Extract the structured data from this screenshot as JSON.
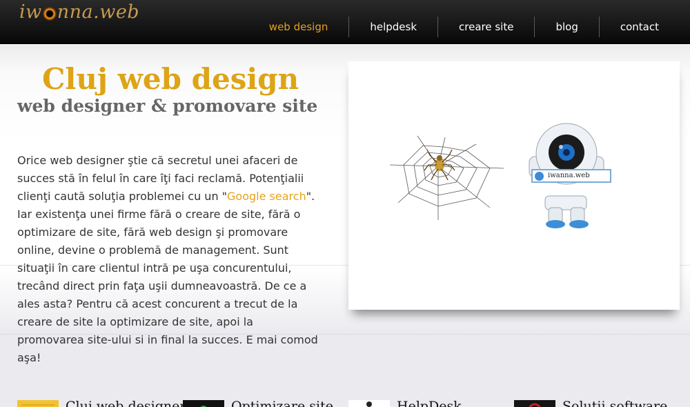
{
  "header": {
    "logo_text_left": "iw",
    "logo_text_right": "nna.web",
    "nav": [
      {
        "label": "web design",
        "active": true
      },
      {
        "label": "helpdesk",
        "active": false
      },
      {
        "label": "creare site",
        "active": false
      },
      {
        "label": "blog",
        "active": false
      },
      {
        "label": "contact",
        "active": false
      }
    ]
  },
  "hero": {
    "title": "Cluj web design",
    "subtitle": "web designer & promovare site",
    "intro_before_link": "Orice web designer ştie că secretul unei afaceri de succes stă în felul în care îţi faci reclamă. Potenţialii clienţi caută soluţia problemei cu un \"",
    "intro_link": "Google search",
    "intro_after_link": "\". Iar existenţa unei firme fără o creare de site, fără o optimizare de site, fără web design şi promovare online, devine o problemă de management. Sunt situaţii în care clientul intră pe uşa concurentului, trecând direct prin faţa uşii dumneavoastră. De ce a ales asta? Pentru că acest concurent a trecut de la creare de site la optimizare de site, apoi la promovarea site-ului si in final la succes. E mai comod aşa!"
  },
  "showcase": {
    "badge_text": "iwanna.web"
  },
  "features": [
    {
      "title": "Cluj web designer",
      "icon": "note-icon"
    },
    {
      "title": "Optimizare site",
      "icon": "monitor-icon"
    },
    {
      "title": "HelpDesk",
      "icon": "support-icon"
    },
    {
      "title": "Soluţii software",
      "icon": "software-icon"
    }
  ],
  "colors": {
    "accent": "#e8a21c",
    "title_gold": "#dda415",
    "header_dark": "#0a0a0a"
  }
}
